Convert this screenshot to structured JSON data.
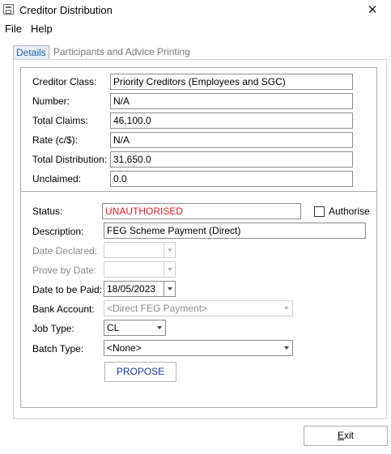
{
  "window": {
    "title": "Creditor Distribution",
    "close_glyph": "✕"
  },
  "menu": {
    "file": "File",
    "help": "Help"
  },
  "tabs": {
    "details": "Details",
    "participants": "Participants and Advice Printing"
  },
  "creditor": {
    "class_label": "Creditor Class:",
    "class_value": "Priority Creditors (Employees and SGC)",
    "number_label": "Number:",
    "number_value": "N/A",
    "total_claims_label": "Total Claims:",
    "total_claims_value": "46,100.0",
    "rate_label": "Rate (c/$):",
    "rate_value": "N/A",
    "total_distribution_label": "Total Distribution:",
    "total_distribution_value": "31,650.0",
    "unclaimed_label": "Unclaimed:",
    "unclaimed_value": "0.0"
  },
  "payment": {
    "status_label": "Status:",
    "status_value": "UNAUTHORISED",
    "authorise_label": "Authorise",
    "authorise_checked": false,
    "description_label": "Description:",
    "description_value": "FEG Scheme Payment (Direct)",
    "date_declared_label": "Date Declared:",
    "date_declared_value": "",
    "prove_by_label": "Prove by Date:",
    "prove_by_value": "",
    "date_to_pay_label": "Date to be Paid:",
    "date_to_pay_value": "18/05/2023",
    "bank_account_label": "Bank Account:",
    "bank_account_value": "<Direct FEG Payment>",
    "job_type_label": "Job Type:",
    "job_type_value": "CL",
    "batch_type_label": "Batch Type:",
    "batch_type_value": "<None>",
    "propose_label": "PROPOSE"
  },
  "footer": {
    "exit_first": "E",
    "exit_rest": "xit"
  },
  "colors": {
    "status_red": "#e01e1e",
    "tab_active_text": "#1c5fad",
    "propose_text": "#1c3aa8"
  }
}
